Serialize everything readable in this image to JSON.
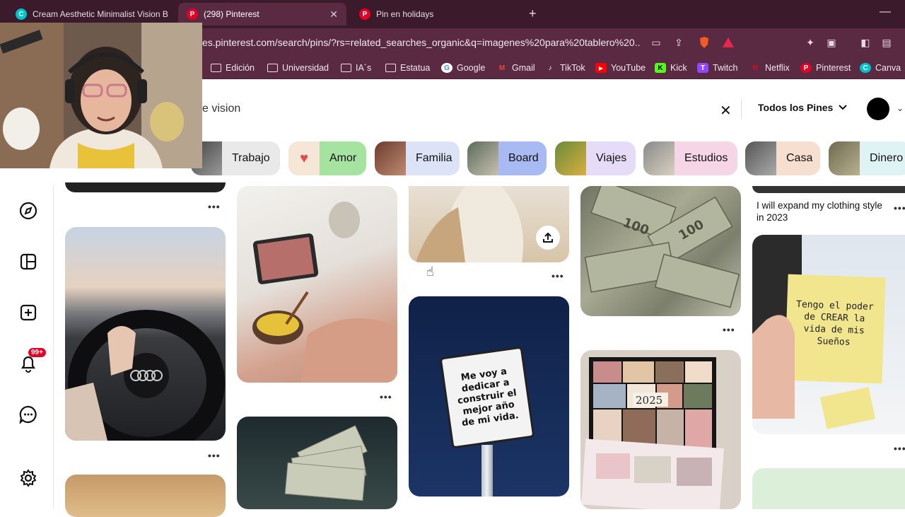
{
  "browser": {
    "tabs": [
      {
        "title": "Cream Aesthetic Minimalist Vision Bo",
        "favicon": "C",
        "favicon_color": "#00c4cc",
        "active": false
      },
      {
        "title": "(298) Pinterest",
        "favicon": "P",
        "favicon_color": "#e60023",
        "active": true
      },
      {
        "title": "Pin en holidays",
        "favicon": "P",
        "favicon_color": "#e60023",
        "active": false
      }
    ],
    "new_tab": "+",
    "minimize": "—",
    "url": "es.pinterest.com/search/pins/?rs=related_searches_organic&q=imagenes%20para%20tablero%20...",
    "bookmarks": [
      {
        "label": "Edición",
        "icon": "folder"
      },
      {
        "label": "Universidad",
        "icon": "folder"
      },
      {
        "label": "IA´s",
        "icon": "folder"
      },
      {
        "label": "Estatua",
        "icon": "folder"
      },
      {
        "label": "Google",
        "icon": "G"
      },
      {
        "label": "Gmail",
        "icon": "M"
      },
      {
        "label": "TikTok",
        "icon": "♪"
      },
      {
        "label": "YouTube",
        "icon": "▶"
      },
      {
        "label": "Kick",
        "icon": "K"
      },
      {
        "label": "Twitch",
        "icon": "T"
      },
      {
        "label": "Netflix",
        "icon": "N"
      },
      {
        "label": "Pinterest",
        "icon": "P"
      },
      {
        "label": "Canva",
        "icon": "C"
      }
    ]
  },
  "search": {
    "query": "e vision",
    "clear_icon": "✕",
    "filter_label": "Todos los Pines"
  },
  "chips": [
    {
      "label": "Trabajo",
      "color": "#e9e9e9"
    },
    {
      "label": "Amor",
      "color": "#a6e3a1"
    },
    {
      "label": "Familia",
      "color": "#dde3f7"
    },
    {
      "label": "Board",
      "color": "#a9b9f2"
    },
    {
      "label": "Viajes",
      "color": "#e6dcf7"
    },
    {
      "label": "Estudios",
      "color": "#f6d5e6"
    },
    {
      "label": "Casa",
      "color": "#f7dfd0"
    },
    {
      "label": "Dinero",
      "color": "#dff2f4"
    }
  ],
  "notifications": {
    "badge": "99+"
  },
  "pins": {
    "caption_col5": "I will expand my clothing style in 2023",
    "sign_text": "Me voy a dedicar a construir el mejor año de mi vida.",
    "note_text": "Tengo el poder de CREAR la vida de mis Sueños",
    "collage_year": "2025",
    "more_label": "•••"
  }
}
